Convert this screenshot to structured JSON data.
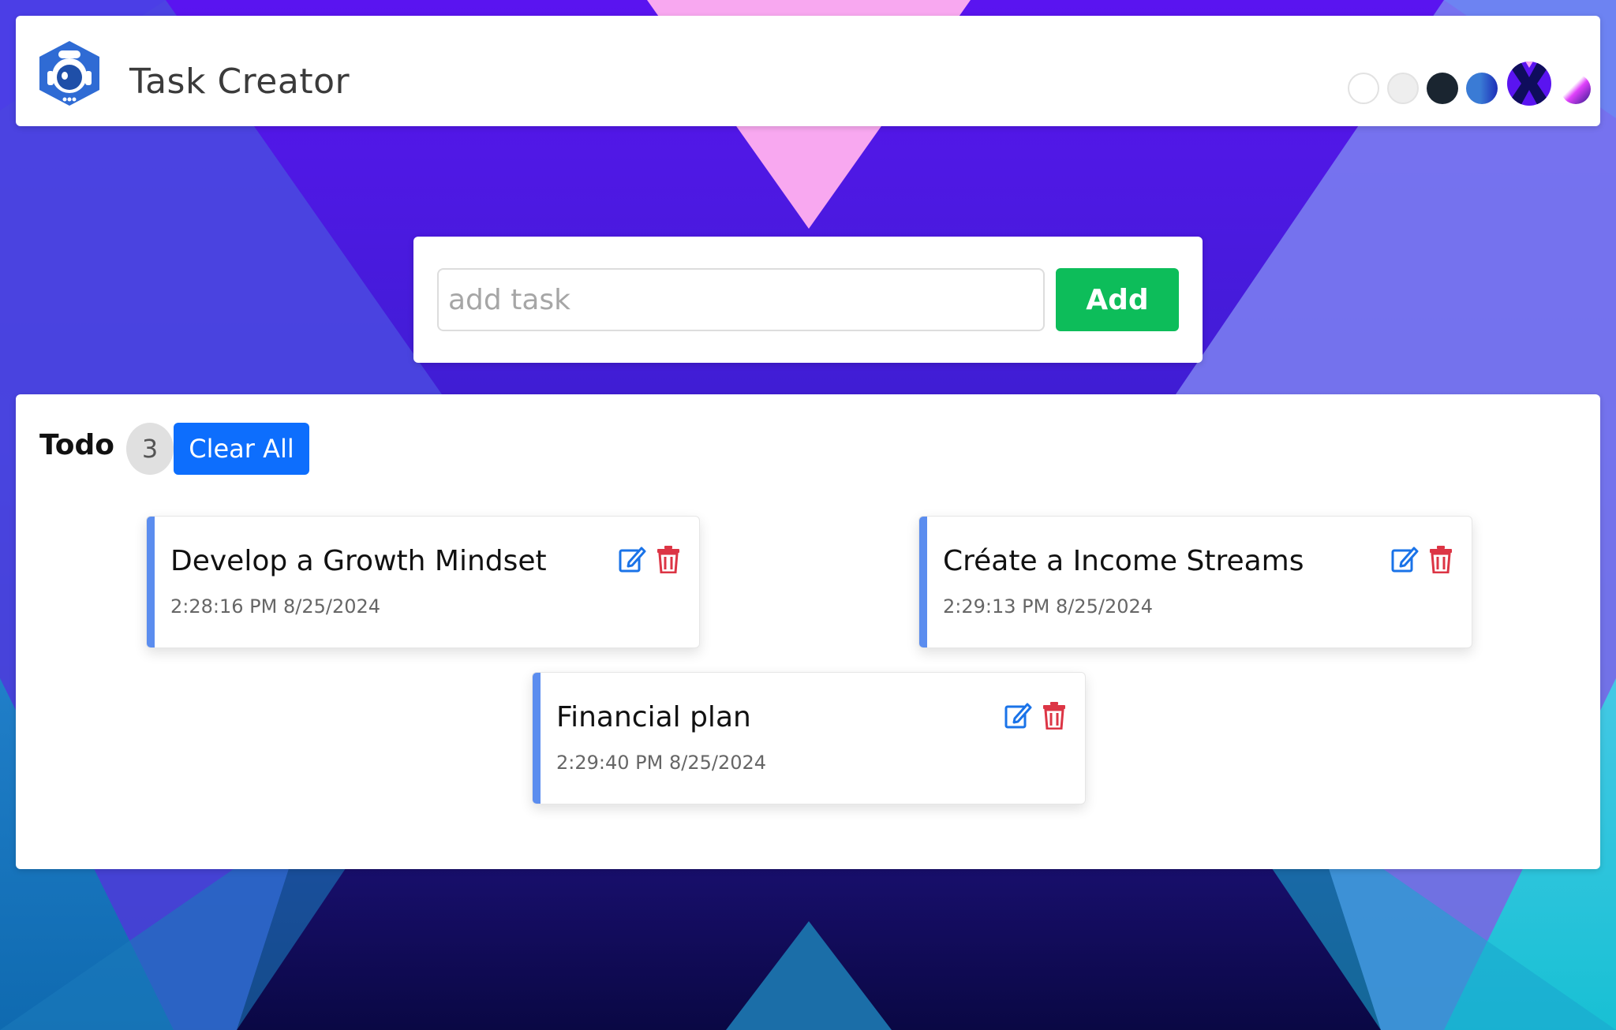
{
  "app": {
    "title": "Task Creator",
    "logo_icon": "robot-logo-icon"
  },
  "theme_switcher": {
    "themes": [
      {
        "name": "white-theme",
        "color": "#ffffff"
      },
      {
        "name": "light-gray-theme",
        "color": "#eeeeee"
      },
      {
        "name": "dark-theme",
        "color": "#1a2530"
      },
      {
        "name": "blue-gradient-theme",
        "color": "#3a7bd5"
      },
      {
        "name": "purple-x-theme",
        "color": "#5a1cff"
      },
      {
        "name": "pink-gradient-theme",
        "color": "#e040fb"
      }
    ]
  },
  "add_task": {
    "placeholder": "add task",
    "value": "",
    "button_label": "Add"
  },
  "todo": {
    "heading": "Todo",
    "count": "3",
    "clear_label": "Clear All",
    "tasks": [
      {
        "title": "Develop a Growth Mindset",
        "time": "2:28:16 PM 8/25/2024"
      },
      {
        "title": "Créate a Income Streams",
        "time": "2:29:13 PM 8/25/2024"
      },
      {
        "title": "Financial plan",
        "time": "2:29:40 PM 8/25/2024"
      }
    ]
  },
  "colors": {
    "accent_green": "#0dbd5a",
    "accent_blue": "#0d6efd",
    "edit_blue": "#1a73e8",
    "delete_red": "#dc3545",
    "card_stripe": "#5b8def"
  }
}
